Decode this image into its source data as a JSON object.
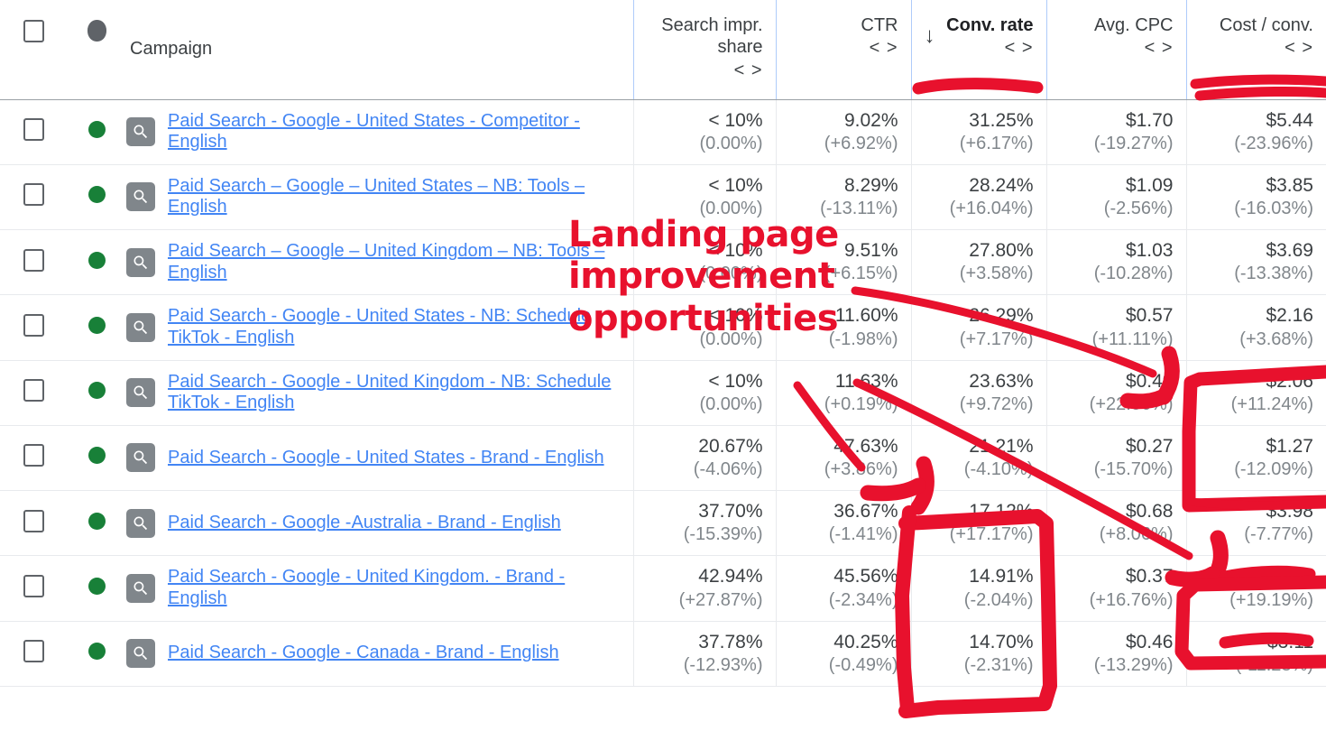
{
  "table": {
    "columns": [
      {
        "key": "checkbox",
        "label": "",
        "icon": "checkbox-icon"
      },
      {
        "key": "status",
        "label": "",
        "icon": "status-dot-icon"
      },
      {
        "key": "campaign",
        "label": "Campaign",
        "sortable": true
      },
      {
        "key": "search_impr_share",
        "label": "Search impr. share",
        "compare": "< >",
        "sorted": false
      },
      {
        "key": "ctr",
        "label": "CTR",
        "compare": "< >",
        "sorted": false
      },
      {
        "key": "conv_rate",
        "label": "Conv. rate",
        "compare": "< >",
        "sorted": true,
        "sort_direction": "↓"
      },
      {
        "key": "avg_cpc",
        "label": "Avg. CPC",
        "compare": "< >",
        "sorted": false
      },
      {
        "key": "cost_per_conv",
        "label": "Cost / conv.",
        "compare": "< >",
        "sorted": false
      }
    ],
    "rows": [
      {
        "campaign": "Paid Search - Google - United States - Competitor - English",
        "status": "enabled",
        "search_impr_share": "< 10%",
        "search_impr_share_delta": "(0.00%)",
        "ctr": "9.02%",
        "ctr_delta": "(+6.92%)",
        "conv_rate": "31.25%",
        "conv_rate_delta": "(+6.17%)",
        "avg_cpc": "$1.70",
        "avg_cpc_delta": "(-19.27%)",
        "cost_per_conv": "$5.44",
        "cost_per_conv_delta": "(-23.96%)"
      },
      {
        "campaign": "Paid Search – Google – United States – NB: Tools – English",
        "status": "enabled",
        "search_impr_share": "< 10%",
        "search_impr_share_delta": "(0.00%)",
        "ctr": "8.29%",
        "ctr_delta": "(-13.11%)",
        "conv_rate": "28.24%",
        "conv_rate_delta": "(+16.04%)",
        "avg_cpc": "$1.09",
        "avg_cpc_delta": "(-2.56%)",
        "cost_per_conv": "$3.85",
        "cost_per_conv_delta": "(-16.03%)"
      },
      {
        "campaign": "Paid Search – Google – United Kingdom – NB: Tools – English",
        "status": "enabled",
        "search_impr_share": "< 10%",
        "search_impr_share_delta": "(0.00%)",
        "ctr": "9.51%",
        "ctr_delta": "(+6.15%)",
        "conv_rate": "27.80%",
        "conv_rate_delta": "(+3.58%)",
        "avg_cpc": "$1.03",
        "avg_cpc_delta": "(-10.28%)",
        "cost_per_conv": "$3.69",
        "cost_per_conv_delta": "(-13.38%)"
      },
      {
        "campaign": "Paid Search - Google - United States - NB: Schedule TikTok - English",
        "status": "enabled",
        "search_impr_share": "< 10%",
        "search_impr_share_delta": "(0.00%)",
        "ctr": "11.60%",
        "ctr_delta": "(-1.98%)",
        "conv_rate": "26.29%",
        "conv_rate_delta": "(+7.17%)",
        "avg_cpc": "$0.57",
        "avg_cpc_delta": "(+11.11%)",
        "cost_per_conv": "$2.16",
        "cost_per_conv_delta": "(+3.68%)"
      },
      {
        "campaign": "Paid Search - Google - United Kingdom - NB: Schedule TikTok - English",
        "status": "enabled",
        "search_impr_share": "< 10%",
        "search_impr_share_delta": "(0.00%)",
        "ctr": "11.63%",
        "ctr_delta": "(+0.19%)",
        "conv_rate": "23.63%",
        "conv_rate_delta": "(+9.72%)",
        "avg_cpc": "$0.49",
        "avg_cpc_delta": "(+22.06%)",
        "cost_per_conv": "$2.06",
        "cost_per_conv_delta": "(+11.24%)"
      },
      {
        "campaign": "Paid Search - Google - United States - Brand - English",
        "status": "enabled",
        "search_impr_share": "20.67%",
        "search_impr_share_delta": "(-4.06%)",
        "ctr": "47.63%",
        "ctr_delta": "(+3.86%)",
        "conv_rate": "21.21%",
        "conv_rate_delta": "(-4.10%)",
        "avg_cpc": "$0.27",
        "avg_cpc_delta": "(-15.70%)",
        "cost_per_conv": "$1.27",
        "cost_per_conv_delta": "(-12.09%)"
      },
      {
        "campaign": "Paid Search - Google -Australia  - Brand - English",
        "status": "enabled",
        "search_impr_share": "37.70%",
        "search_impr_share_delta": "(-15.39%)",
        "ctr": "36.67%",
        "ctr_delta": "(-1.41%)",
        "conv_rate": "17.12%",
        "conv_rate_delta": "(+17.17%)",
        "avg_cpc": "$0.68",
        "avg_cpc_delta": "(+8.06%)",
        "cost_per_conv": "$3.98",
        "cost_per_conv_delta": "(-7.77%)"
      },
      {
        "campaign": "Paid Search - Google - United Kingdom. - Brand - English",
        "status": "enabled",
        "search_impr_share": "42.94%",
        "search_impr_share_delta": "(+27.87%)",
        "ctr": "45.56%",
        "ctr_delta": "(-2.34%)",
        "conv_rate": "14.91%",
        "conv_rate_delta": "(-2.04%)",
        "avg_cpc": "$0.37",
        "avg_cpc_delta": "(+16.76%)",
        "cost_per_conv": "$2.47",
        "cost_per_conv_delta": "(+19.19%)"
      },
      {
        "campaign": "Paid Search - Google - Canada - Brand - English",
        "status": "enabled",
        "search_impr_share": "37.78%",
        "search_impr_share_delta": "(-12.93%)",
        "ctr": "40.25%",
        "ctr_delta": "(-0.49%)",
        "conv_rate": "14.70%",
        "conv_rate_delta": "(-2.31%)",
        "avg_cpc": "$0.46",
        "avg_cpc_delta": "(-13.29%)",
        "cost_per_conv": "$3.11",
        "cost_per_conv_delta": "(-11.23%)"
      }
    ]
  },
  "annotation": {
    "text": "Landing page improvement opportunities",
    "color": "#e8112d",
    "marks": [
      "underline-conv-rate-header",
      "underline-cost-conv-header",
      "arrow-to-avg-cpc-row4",
      "arrow-to-ctr-row6",
      "arrow-to-cost-conv-row7",
      "box-cost-conv-row5",
      "box-cost-conv-row8",
      "box-conv-rate-rows7to9"
    ]
  },
  "colors": {
    "link": "#4285f4",
    "status_enabled": "#188038",
    "annotation_red": "#e8112d",
    "header_text": "#3c4043",
    "delta_text": "#80868b",
    "header_border": "#aecbfa"
  }
}
